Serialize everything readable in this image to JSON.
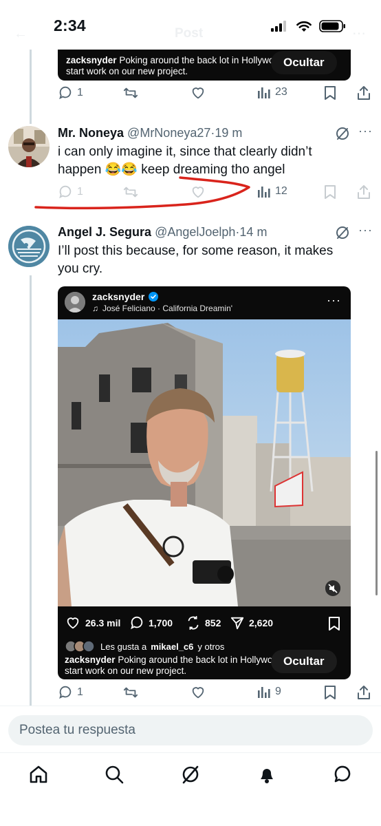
{
  "status_bar": {
    "time": "2:34"
  },
  "header_ghost": {
    "title": "Post"
  },
  "top_embed": {
    "username": "zacksnyder",
    "caption": "Poking around the back lot in Hollywo",
    "caption_line2": "start work on our new project.",
    "hide_label": "Ocultar"
  },
  "top_actions": {
    "replies": "1",
    "views": "23"
  },
  "reply_tweet": {
    "name": "Mr. Noneya",
    "handle": "@MrNoneya27",
    "time": "19 m",
    "text_line1": "i can only imagine it, since that clearly didn’t",
    "text_line2_a": "happen",
    "emojis": "😂😂",
    "text_line2_b": "keep dreaming tho angel",
    "actions": {
      "replies": "1",
      "views": "12"
    }
  },
  "main_tweet": {
    "name": "Angel J. Segura",
    "handle": "@AngelJoelph",
    "time": "14 m",
    "text_line1": "I’ll post this because, for some reason, it makes",
    "text_line2": "you cry.",
    "embed": {
      "username": "zacksnyder",
      "music": "José Feliciano · California Dreamin'",
      "likes": "26.3 mil",
      "comments": "1,700",
      "reposts": "852",
      "shares": "2,620",
      "liked_by_prefix": "Les gusta a",
      "liked_by_user": "mikael_c6",
      "liked_by_suffix": "y otros",
      "caption": "Poking around the back lot in Hollywo",
      "caption_line2": "start work on our new project.",
      "hide_label": "Ocultar"
    },
    "actions": {
      "replies": "1",
      "views": "9"
    }
  },
  "reply_box": {
    "placeholder": "Postea tu respuesta"
  },
  "colors": {
    "text": "#0f1419",
    "secondary": "#536471",
    "divider": "#cfd9de",
    "verified": "#0095f6",
    "annotation": "#d9241c"
  },
  "nav_icons": [
    "home-icon",
    "search-icon",
    "grok-icon",
    "notifications-bell-icon",
    "messages-icon"
  ]
}
